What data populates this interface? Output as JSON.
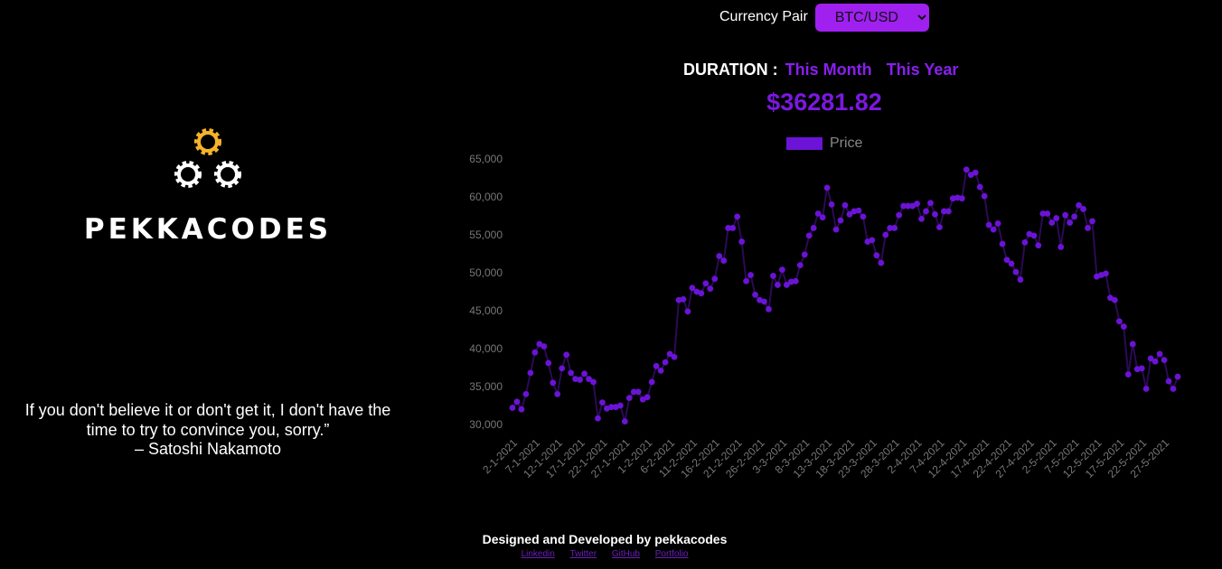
{
  "brand": {
    "name": "PEKKACODES"
  },
  "quote": {
    "text": "If you don't believe it or don't get it, I don't have the time to try to convince you, sorry.”",
    "author": "– Satoshi Nakamoto"
  },
  "currency": {
    "label": "Currency Pair",
    "selected": "BTC/USD"
  },
  "duration": {
    "label": "DURATION :",
    "options": [
      "This Month",
      "This Year"
    ]
  },
  "price": {
    "current": "$36281.82"
  },
  "colors": {
    "accent": "#7b18e0",
    "select_bg": "#a020f0",
    "gear_gold": "#f5b32a",
    "background": "#000000"
  },
  "icons": [
    "gear-icon-gold",
    "gear-icon-white",
    "gear-icon-white"
  ],
  "footer": {
    "credit": "Designed and Developed by pekkacodes",
    "links": [
      "Linkedin",
      "Twitter",
      "GitHub",
      "Portfolio"
    ]
  },
  "chart_data": {
    "type": "line",
    "legend": [
      "Price"
    ],
    "legend_position": "top",
    "ylim": [
      30000,
      65000
    ],
    "y_ticks": [
      30000,
      35000,
      40000,
      45000,
      50000,
      55000,
      60000,
      65000
    ],
    "y_tick_labels": [
      "30,000",
      "35,000",
      "40,000",
      "45,000",
      "50,000",
      "55,000",
      "60,000",
      "65,000"
    ],
    "x_tick_labels": [
      "2-1-2021",
      "7-1-2021",
      "12-1-2021",
      "17-1-2021",
      "22-1-2021",
      "27-1-2021",
      "1-2-2021",
      "6-2-2021",
      "11-2-2021",
      "16-2-2021",
      "21-2-2021",
      "26-2-2021",
      "3-3-2021",
      "8-3-2021",
      "13-3-2021",
      "18-3-2021",
      "23-3-2021",
      "28-3-2021",
      "2-4-2021",
      "7-4-2021",
      "12-4-2021",
      "17-4-2021",
      "22-4-2021",
      "27-4-2021",
      "2-5-2021",
      "7-5-2021",
      "12-5-2021",
      "17-5-2021",
      "22-5-2021",
      "27-5-2021"
    ],
    "series": [
      {
        "name": "Price",
        "values": [
          32200,
          33000,
          32000,
          34000,
          36800,
          39500,
          40600,
          40300,
          38100,
          35500,
          34000,
          37400,
          39200,
          36800,
          36000,
          35900,
          36700,
          36000,
          35600,
          30800,
          32900,
          32100,
          32300,
          32300,
          32500,
          30400,
          33500,
          34300,
          34300,
          33300,
          33600,
          35600,
          37700,
          37100,
          38200,
          39300,
          38900,
          46400,
          46500,
          44900,
          48000,
          47500,
          47300,
          48600,
          47900,
          49200,
          52200,
          51600,
          55900,
          55900,
          57400,
          54100,
          48900,
          49700,
          47100,
          46400,
          46200,
          45200,
          49600,
          48400,
          50400,
          48400,
          48800,
          48900,
          51000,
          52400,
          54900,
          55900,
          57800,
          57300,
          61200,
          59000,
          55700,
          56900,
          58900,
          57700,
          58100,
          58200,
          57400,
          54100,
          54300,
          52300,
          51300,
          55000,
          55900,
          55900,
          57600,
          58800,
          58800,
          58800,
          59100,
          57100,
          58100,
          59200,
          57700,
          56000,
          58100,
          58100,
          59800,
          59900,
          59800,
          63600,
          62900,
          63200,
          61300,
          60100,
          56300,
          55700,
          56500,
          53800,
          51700,
          51200,
          50100,
          49100,
          54000,
          55100,
          54900,
          53600,
          57800,
          57800,
          56600,
          57200,
          53400,
          57600,
          56600,
          57400,
          58900,
          58400,
          55900,
          56800,
          49500,
          49700,
          49900,
          46700,
          46400,
          43600,
          42900,
          36600,
          40600,
          37300,
          37400,
          34700,
          38700,
          38300,
          39300,
          38500,
          35700,
          34700,
          36300
        ]
      }
    ]
  }
}
